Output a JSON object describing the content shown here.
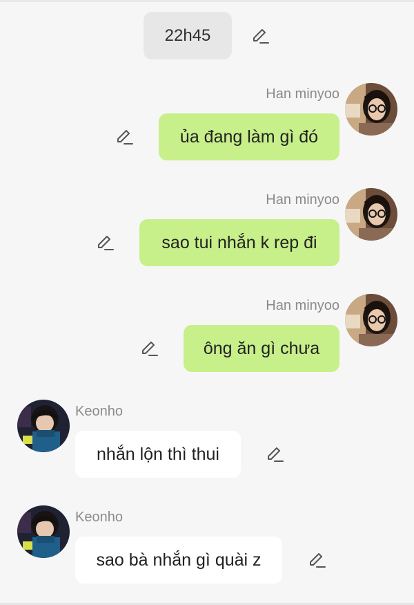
{
  "colors": {
    "background": "#f6f6f6",
    "sent_bubble": "#c7ef8a",
    "received_bubble": "#ffffff",
    "sender_name": "#8a8a8a",
    "time_chip": "#e7e7e7",
    "edit_icon": "#555555"
  },
  "time_separator": {
    "label": "22h45",
    "icon": "pencil-icon"
  },
  "messages": [
    {
      "sender": "Han minyoo",
      "text": "ủa đang làm gì đó",
      "direction": "sent",
      "icon": "pencil-icon"
    },
    {
      "sender": "Han minyoo",
      "text": "sao tui nhắn k rep đi",
      "direction": "sent",
      "icon": "pencil-icon"
    },
    {
      "sender": "Han minyoo",
      "text": "ông ăn gì chưa",
      "direction": "sent",
      "icon": "pencil-icon"
    },
    {
      "sender": "Keonho",
      "text": "nhắn lộn thì thui",
      "direction": "received",
      "icon": "pencil-icon"
    },
    {
      "sender": "Keonho",
      "text": "sao bà nhắn gì quài z",
      "direction": "received",
      "icon": "pencil-icon"
    }
  ]
}
